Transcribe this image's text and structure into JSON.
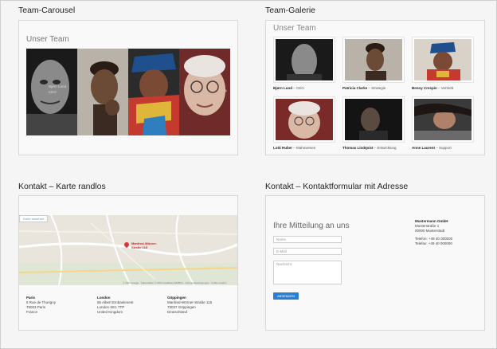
{
  "sections": {
    "carousel_title": "Team-Carousel",
    "gallery_title": "Team-Galerie",
    "map_title": "Kontakt – Karte randlos",
    "form_title": "Kontakt – Kontaktformular mit Adresse"
  },
  "carousel": {
    "heading": "Unser Team",
    "caption_line1": "Bjørn Lund",
    "caption_line2": "CEO",
    "arrow": "›"
  },
  "gallery": {
    "heading": "Unser Team",
    "members": [
      {
        "name": "Bjørn Lund",
        "role": "– CEO"
      },
      {
        "name": "Patricia Clarke",
        "role": "– Strategie"
      },
      {
        "name": "Benny Crespin",
        "role": "– Vertrieb"
      },
      {
        "name": "Lotti Huber",
        "role": "– Mahnwesen"
      },
      {
        "name": "Thomas Lindqvist",
        "role": "– Entwicklung"
      },
      {
        "name": "Anne Laurent",
        "role": "– Support"
      }
    ]
  },
  "map": {
    "tab_label": "Karte ansehen",
    "pin_label": "Manfred-Wörner-Straße 115",
    "footer": "© 2023 Google · Kartendaten © 2023 GeoBasis-DE/BKG · Nutzungsbedingungen · Fehler melden",
    "addresses": [
      {
        "city": "Paris",
        "line1": "5 Rue de Thorigny",
        "line2": "75003 Paris",
        "line3": "France"
      },
      {
        "city": "London",
        "line1": "85 Albert Embankment",
        "line2": "London SE1 7TP",
        "line3": "United Kingdom"
      },
      {
        "city": "Göppingen",
        "line1": "Manfred-Wörner-Straße 115",
        "line2": "73037 Göppingen",
        "line3": "Deutschland"
      }
    ]
  },
  "form": {
    "heading": "Ihre Mitteilung an uns",
    "name_placeholder": "Name",
    "email_placeholder": "E-Mail",
    "message_placeholder": "Nachricht",
    "send_label": "ABSENDEN",
    "company": "Mustermann GmbH",
    "street": "Musterstraße 1",
    "city": "00000 Musterstadt",
    "phone": "Telefon: +49 40 000000",
    "fax": "Telefax: +49 40 000000"
  }
}
